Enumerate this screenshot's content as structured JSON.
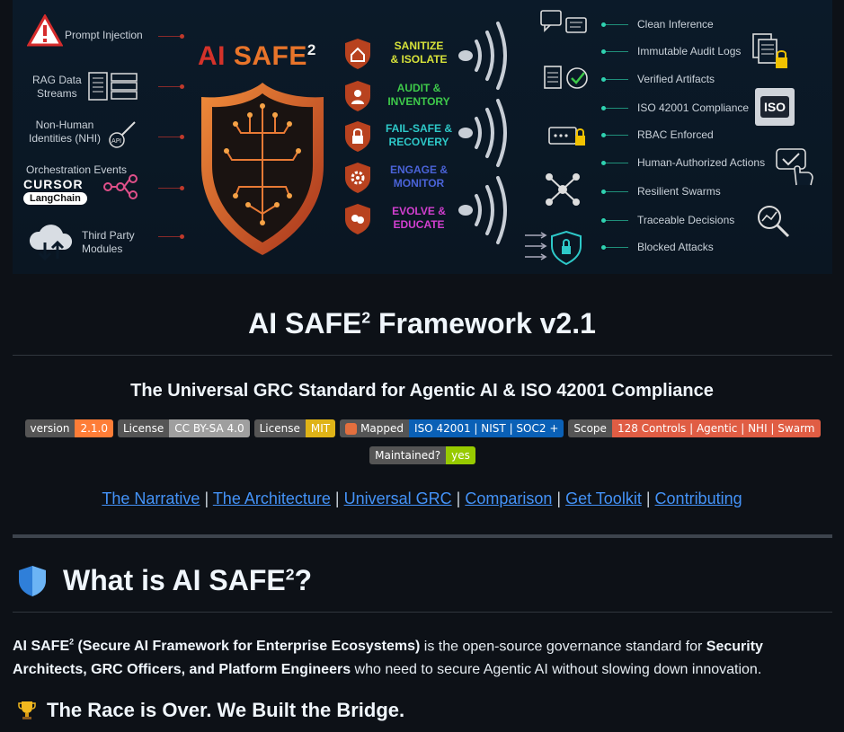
{
  "banner": {
    "left_labels": {
      "prompt_injection": "Prompt Injection",
      "rag_line1": "RAG Data",
      "rag_line2": "Streams",
      "nhi_line1": "Non-Human",
      "nhi_line2": "Identities (NHI)",
      "orchestration": "Orchestration Events",
      "cursor": "CURSOR",
      "langchain": "LangChain",
      "third_line1": "Third Party",
      "third_line2": "Modules",
      "api": "API"
    },
    "title": {
      "ai": "AI",
      "safe": "SAFE",
      "sup": "2"
    },
    "pillars": [
      {
        "line1": "SANITIZE",
        "line2": "& ISOLATE",
        "color": "#d7e23a"
      },
      {
        "line1": "AUDIT &",
        "line2": "INVENTORY",
        "color": "#3ec94a"
      },
      {
        "line1": "FAIL-SAFE &",
        "line2": "RECOVERY",
        "color": "#2ec9c9"
      },
      {
        "line1": "ENGAGE &",
        "line2": "MONITOR",
        "color": "#4a63d8"
      },
      {
        "line1": "EVOLVE &",
        "line2": "EDUCATE",
        "color": "#d23fd0"
      }
    ],
    "right_labels": [
      "Clean Inference",
      "Immutable Audit Logs",
      "Verified Artifacts",
      "ISO 42001 Compliance",
      "RBAC Enforced",
      "Human-Authorized Actions",
      "Resilient Swarms",
      "Traceable Decisions",
      "Blocked Attacks"
    ],
    "iso_text": "ISO"
  },
  "header": {
    "title_main": "AI SAFE",
    "title_sup": "2",
    "title_rest": " Framework v2.1",
    "subtitle": "The Universal GRC Standard for Agentic AI & ISO 42001 Compliance"
  },
  "badges": [
    {
      "key": "version",
      "value": "2.1.0",
      "color": "#fe7d37"
    },
    {
      "key": "License",
      "value": "CC BY-SA 4.0",
      "color": "#9f9f9f"
    },
    {
      "key": "License",
      "value": "MIT",
      "color": "#dfb317"
    },
    {
      "key": "Mapped",
      "value": "ISO 42001 | NIST | SOC2 +",
      "color": "#0a60b6"
    },
    {
      "key": "Scope",
      "value": "128 Controls | Agentic | NHI | Swarm",
      "color": "#e05d44"
    },
    {
      "key": "Maintained?",
      "value": "yes",
      "color": "#97ca00"
    }
  ],
  "nav_links": [
    "The Narrative",
    "The Architecture",
    "Universal GRC",
    "Comparison",
    "Get Toolkit",
    "Contributing"
  ],
  "nav_separator": "|",
  "section": {
    "heading_main": "What is AI SAFE",
    "heading_sup": "2",
    "heading_end": "?",
    "para_b1": "AI SAFE",
    "para_b1_sup": "2",
    "para_b1_rest": " (Secure AI Framework for Enterprise Ecosystems)",
    "para_mid": " is the open-source governance standard for ",
    "para_b2": "Security Architects, GRC Officers, and Platform Engineers",
    "para_end": " who need to secure Agentic AI without slowing down innovation.",
    "h3": "The Race is Over. We Built the Bridge."
  }
}
